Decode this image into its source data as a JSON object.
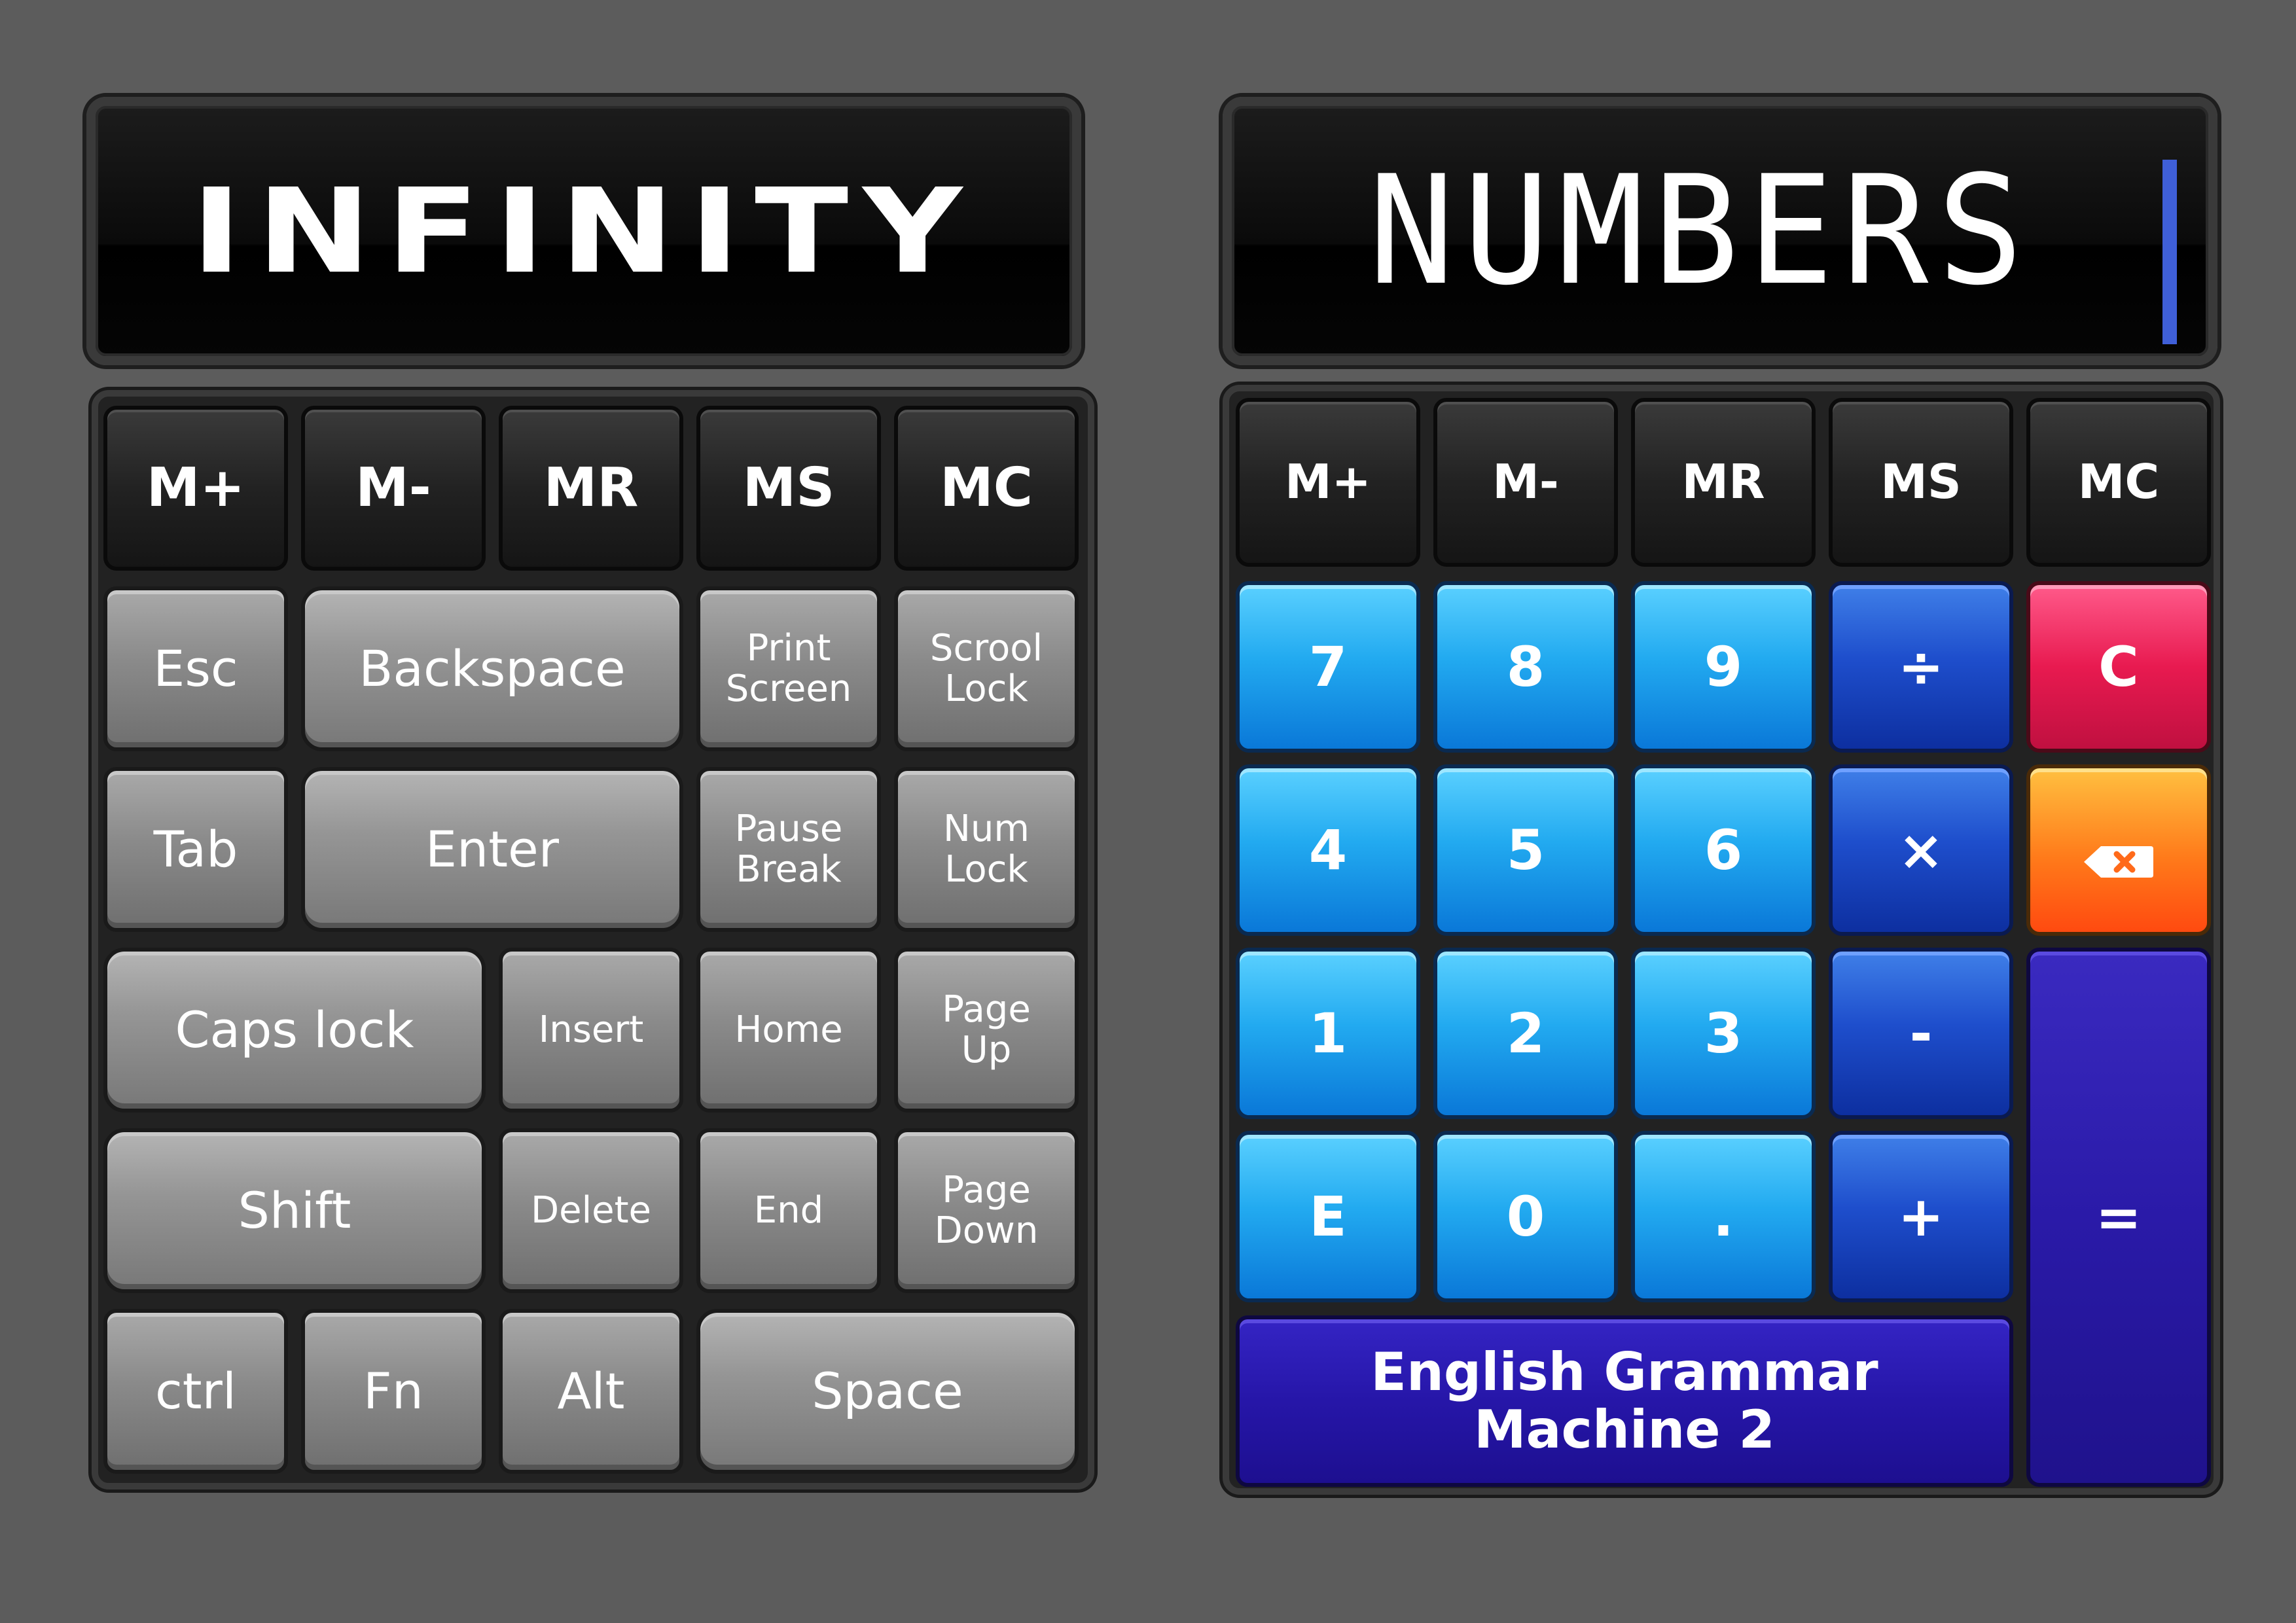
{
  "left": {
    "display": "INFINITY",
    "memory": [
      "M+",
      "M-",
      "MR",
      "MS",
      "MC"
    ],
    "keys": {
      "esc": "Esc",
      "backspace": "Backspace",
      "print_screen": "Print\nScreen",
      "scroll_lock": "Scrool\nLock",
      "tab": "Tab",
      "enter": "Enter",
      "pause_break": "Pause\nBreak",
      "num_lock": "Num\nLock",
      "caps_lock": "Caps lock",
      "insert": "Insert",
      "home": "Home",
      "page_up": "Page\nUp",
      "shift": "Shift",
      "delete": "Delete",
      "end": "End",
      "page_down": "Page\nDown",
      "ctrl": "ctrl",
      "fn": "Fn",
      "alt": "Alt",
      "space": "Space"
    }
  },
  "right": {
    "display": "NUMBERS",
    "memory": [
      "M+",
      "M-",
      "MR",
      "MS",
      "MC"
    ],
    "keys": {
      "k7": "7",
      "k8": "8",
      "k9": "9",
      "divide": "÷",
      "clear": "C",
      "k4": "4",
      "k5": "5",
      "k6": "6",
      "multiply": "×",
      "k1": "1",
      "k2": "2",
      "k3": "3",
      "minus": "-",
      "e": "E",
      "k0": "0",
      "dot": ".",
      "plus": "+",
      "equals": "=",
      "banner": "English Grammar Machine 2"
    },
    "icons": {
      "backspace": "backspace-icon"
    },
    "colors": {
      "cursor": "#3f5fd8",
      "clear": "#e81a50",
      "backspace": "#ff7a1a"
    }
  }
}
